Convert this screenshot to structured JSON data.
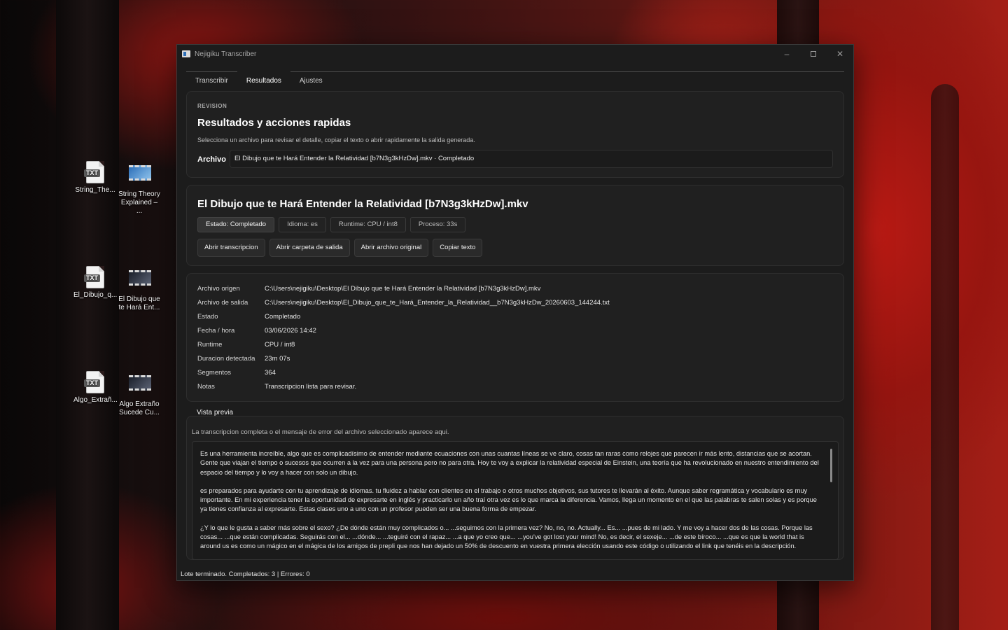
{
  "desktop": {
    "icons": [
      {
        "label": "String_The...",
        "kind": "txt",
        "badge": "TXT"
      },
      {
        "label": "String Theory Explained – ...",
        "kind": "video"
      },
      {
        "label": "El_Dibujo_q...",
        "kind": "txt",
        "badge": "TXT"
      },
      {
        "label": "El Dibujo que te Hará Ent...",
        "kind": "video"
      },
      {
        "label": "Algo_Extrañ...",
        "kind": "txt",
        "badge": "TXT"
      },
      {
        "label": "Algo Extraño Sucede Cu...",
        "kind": "video"
      }
    ]
  },
  "window": {
    "title": "Nejigiku Transcriber",
    "controls": {
      "minimize": "–",
      "close": "✕"
    }
  },
  "tabs": [
    {
      "label": "Transcribir",
      "active": false
    },
    {
      "label": "Resultados",
      "active": true
    },
    {
      "label": "Ajustes",
      "active": false
    }
  ],
  "review": {
    "eyebrow": "REVISION",
    "title": "Resultados y acciones rapidas",
    "subtitle": "Selecciona un archivo para revisar el detalle, copiar el texto o abrir rapidamente la salida generada.",
    "archivo_label": "Archivo",
    "archivo_value": "El Dibujo que te Hará Entender la Relatividad [b7N3g3kHzDw].mkv · Completado"
  },
  "detail": {
    "title": "El Dibujo que te Hará Entender la Relatividad [b7N3g3kHzDw].mkv",
    "chips": [
      "Estado: Completado",
      "Idioma: es",
      "Runtime: CPU / int8",
      "Proceso: 33s"
    ],
    "actions": [
      "Abrir transcripcion",
      "Abrir carpeta de salida",
      "Abrir archivo original",
      "Copiar texto"
    ]
  },
  "meta": [
    {
      "key": "Archivo origen",
      "value": "C:\\Users\\nejigiku\\Desktop\\El Dibujo que te Hará Entender la Relatividad [b7N3g3kHzDw].mkv"
    },
    {
      "key": "Archivo de salida",
      "value": "C:\\Users\\nejigiku\\Desktop\\El_Dibujo_que_te_Hará_Entender_la_Relatividad__b7N3g3kHzDw_20260603_144244.txt"
    },
    {
      "key": "Estado",
      "value": "Completado"
    },
    {
      "key": "Fecha / hora",
      "value": "03/06/2026 14:42"
    },
    {
      "key": "Runtime",
      "value": "CPU / int8"
    },
    {
      "key": "Duracion detectada",
      "value": "23m 07s"
    },
    {
      "key": "Segmentos",
      "value": "364"
    },
    {
      "key": "Notas",
      "value": "Transcripcion lista para revisar."
    }
  ],
  "preview": {
    "title": "Vista previa",
    "subtitle": "La transcripcion completa o el mensaje de error del archivo seleccionado aparece aqui.",
    "paragraphs": [
      "Es una herramienta increíble, algo que es complicadísimo de entender mediante ecuaciones con unas cuantas líneas se ve claro, cosas tan raras como relojes que parecen ir más lento, distancias que se acortan. Gente que viajan el tiempo o sucesos que ocurren a la vez para una persona pero no para otra. Hoy te voy a explicar la relatividad especial de Einstein, una teoría que ha revolucionado en nuestro entendimiento del espacio del tiempo y lo voy a hacer con solo un dibujo.",
      "es preparados para ayudarte con tu aprendizaje de idiomas. tu fluidez a hablar con clientes en el trabajo o otros muchos objetivos, sus tutores te llevarán al éxito. Aunque saber regramática y vocabulario es muy importante. En mi experiencia tener la oportunidad de expresarte en inglés y practicarlo un año traí otra vez es lo que marca la diferencia. Vamos, llega un momento en el que las palabras te salen solas y es porque ya tienes confianza al expresarte. Estas clases uno a uno con un profesor pueden ser una buena forma de empezar.",
      "¿Y lo que le gusta a saber más sobre el sexo? ¿De dónde están muy complicados o... ...seguimos con la primera vez? No, no, no. Actually... Es... ...pues de mi lado. Y me voy a hacer dos de las cosas. Porque las cosas... ...que están complicadas. Seguirás con el... ...dónde... ...teguiré con el rapaz... ...a que yo creo que... ...you've got lost your mind! No, es decir, el sexeje... ...de este bíroco... ...que es que la world that is around us es como un mágico en el mágica de los amigos de prepli que nos han dejado un 50% de descuento en vuestra primera elección usando este código o utilizando el link que tenéis en la descripción."
    ]
  },
  "status": "Lote terminado. Completados: 3 | Errores: 0"
}
